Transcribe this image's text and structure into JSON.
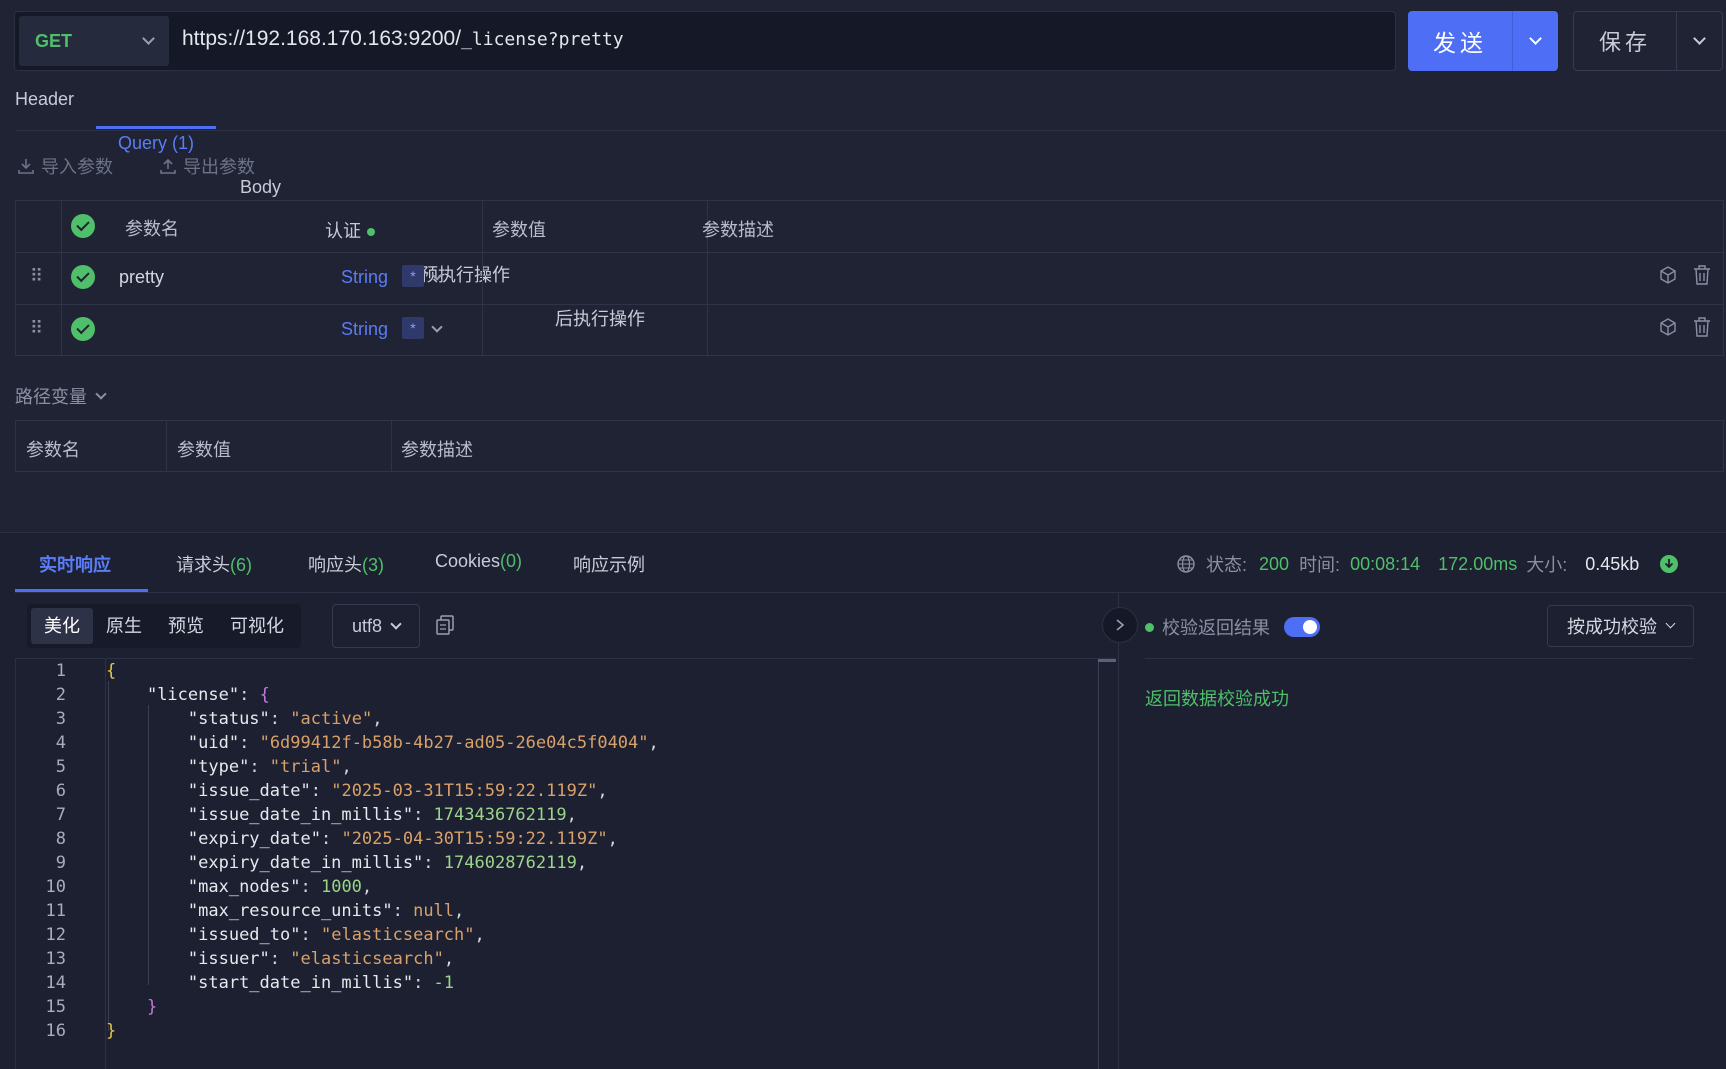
{
  "request": {
    "method": "GET",
    "url_host": "https://192.168.170.163:9200/",
    "url_path": "_license?pretty",
    "send_label": "发送",
    "save_label": "保存"
  },
  "tabs": [
    {
      "label": "Header",
      "count": ""
    },
    {
      "label": "Query",
      "count": "(1)"
    },
    {
      "label": "Body",
      "count": ""
    },
    {
      "label": "认证",
      "count": ""
    },
    {
      "label": "预执行操作",
      "count": ""
    },
    {
      "label": "后执行操作",
      "count": ""
    }
  ],
  "query_toolbar": {
    "import_label": "导入参数",
    "export_label": "导出参数"
  },
  "query_table": {
    "headers": {
      "name": "参数名",
      "value": "参数值",
      "desc": "参数描述"
    },
    "rows": [
      {
        "name": "pretty",
        "type": "String",
        "required": "*",
        "value": "",
        "desc": ""
      },
      {
        "name": "",
        "type": "String",
        "required": "*",
        "value": "",
        "desc": ""
      }
    ]
  },
  "path_vars": {
    "title": "路径变量",
    "headers": {
      "name": "参数名",
      "value": "参数值",
      "desc": "参数描述"
    }
  },
  "response": {
    "tabs": [
      {
        "label": "实时响应",
        "count": ""
      },
      {
        "label": "请求头",
        "count": "(6)"
      },
      {
        "label": "响应头",
        "count": "(3)"
      },
      {
        "label": "Cookies",
        "count": "(0)"
      },
      {
        "label": "响应示例",
        "count": ""
      }
    ],
    "status_label": "状态:",
    "status_value": "200",
    "time_label": "时间:",
    "time_value": "00:08:14",
    "duration_value": "172.00ms",
    "size_label": "大小:",
    "size_value": "0.45kb",
    "view_modes": [
      "美化",
      "原生",
      "预览",
      "可视化"
    ],
    "encoding": "utf8",
    "validate_label": "校验返回结果",
    "validate_enabled": true,
    "validate_mode": "按成功校验",
    "validate_message": "返回数据校验成功"
  },
  "code_lines": [
    "1",
    "2",
    "3",
    "4",
    "5",
    "6",
    "7",
    "8",
    "9",
    "10",
    "11",
    "12",
    "13",
    "14",
    "15",
    "16"
  ],
  "json_body": {
    "status": "active",
    "uid": "6d99412f-b58b-4b27-ad05-26e04c5f0404",
    "type": "trial",
    "issue_date": "2025-03-31T15:59:22.119Z",
    "issue_date_in_millis": "1743436762119",
    "expiry_date": "2025-04-30T15:59:22.119Z",
    "expiry_date_in_millis": "1746028762119",
    "max_nodes": "1000",
    "max_resource_units": "null",
    "issued_to": "elasticsearch",
    "issuer": "elasticsearch",
    "start_date_in_millis": "-1"
  },
  "colors": {
    "accent": "#5b7cf7",
    "success": "#4fbf6a",
    "background": "#1f2334"
  }
}
